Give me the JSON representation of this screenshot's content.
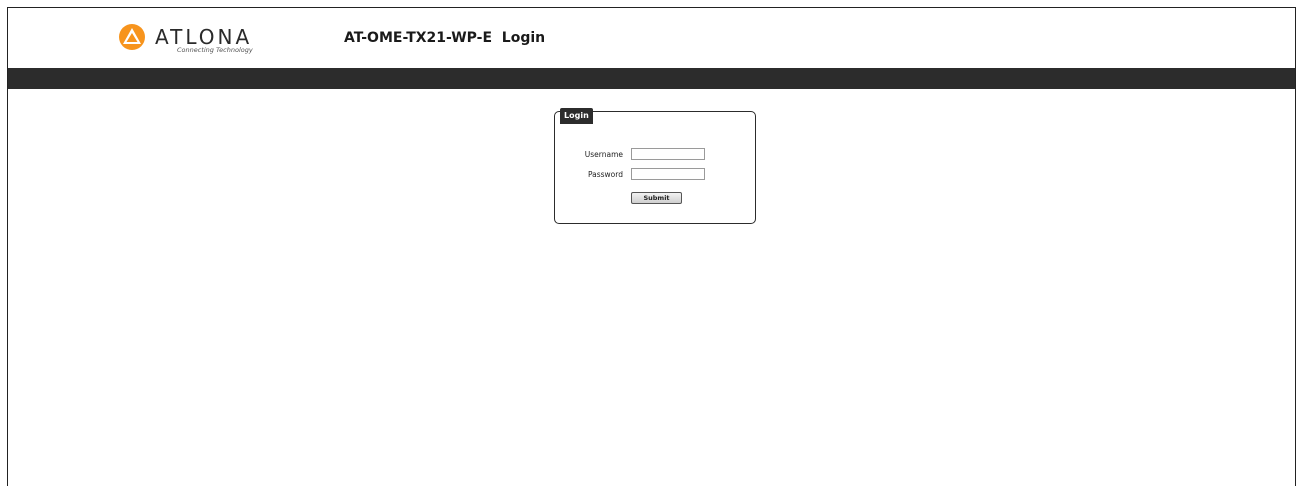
{
  "header": {
    "brand_name": "ATLONA",
    "brand_tagline": "Connecting Technology",
    "page_title": "AT-OME-TX21-WP-E  Login"
  },
  "login": {
    "legend": "Login",
    "username_label": "Username",
    "username_value": "",
    "password_label": "Password",
    "password_value": "",
    "submit_label": "Submit"
  },
  "colors": {
    "brand_orange": "#f7941d",
    "nav_bar": "#2c2c2c",
    "legend_bg": "#2c2c2c"
  },
  "icons": {
    "logo": "atlona-logo-icon"
  }
}
